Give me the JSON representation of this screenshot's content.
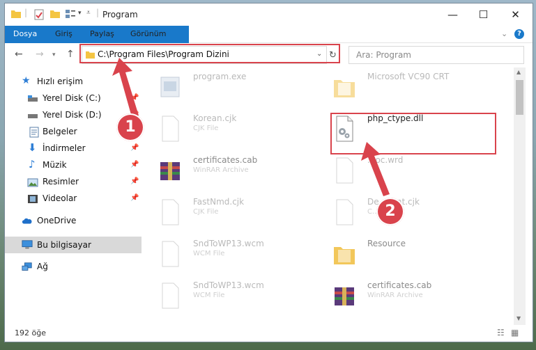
{
  "window": {
    "title": "Program"
  },
  "ribbon": {
    "tabs": [
      "Dosya",
      "Giriş",
      "Paylaş",
      "Görünüm"
    ]
  },
  "address": {
    "path": "C:\\Program Files\\Program Dizini"
  },
  "search": {
    "placeholder": "Ara: Program"
  },
  "sidebar": {
    "quick_access": "Hızlı erişim",
    "items": [
      "Yerel Disk (C:)",
      "Yerel Disk (D:)",
      "Belgeler",
      "İndirmeler",
      "Müzik",
      "Resimler",
      "Videolar"
    ],
    "onedrive": "OneDrive",
    "this_pc": "Bu bilgisayar",
    "network": "Ağ"
  },
  "files": [
    {
      "name": "program.exe",
      "type": ""
    },
    {
      "name": "Microsoft VC90 CRT",
      "type": ""
    },
    {
      "name": "Korean.cjk",
      "type": "CJK File"
    },
    {
      "name": "php_ctype.dll",
      "type": ""
    },
    {
      "name": "certificates.cab",
      "type": "WinRAR Archive"
    },
    {
      "name": "...oc.wrd",
      "type": ""
    },
    {
      "name": "FastNmd.cjk",
      "type": "CJK File"
    },
    {
      "name": "De...Font.cjk",
      "type": "C..."
    },
    {
      "name": "SndToWP13.wcm",
      "type": "WCM File"
    },
    {
      "name": "Resource",
      "type": ""
    },
    {
      "name": "SndToWP13.wcm",
      "type": "WCM File"
    },
    {
      "name": "certificates.cab",
      "type": "WinRAR Archive"
    }
  ],
  "status": {
    "count": "192 öğe"
  },
  "annotations": {
    "step1": "1",
    "step2": "2",
    "accent": "#d9434c"
  }
}
